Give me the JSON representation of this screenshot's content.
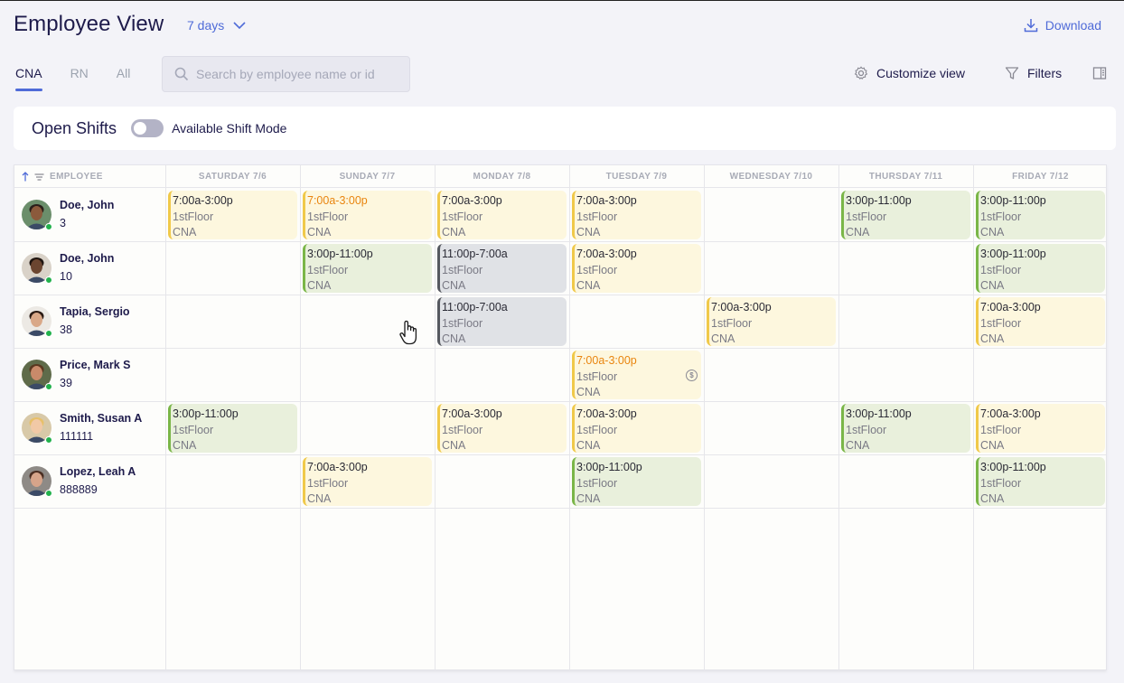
{
  "header": {
    "title": "Employee View",
    "range_label": "7 days",
    "download_label": "Download"
  },
  "tabs": [
    {
      "label": "CNA",
      "active": true
    },
    {
      "label": "RN",
      "active": false
    },
    {
      "label": "All",
      "active": false
    }
  ],
  "search": {
    "placeholder": "Search by employee name or id",
    "value": ""
  },
  "toolbar": {
    "customize_label": "Customize view",
    "filters_label": "Filters"
  },
  "open_shifts": {
    "label": "Open Shifts",
    "toggle_label": "Available Shift Mode",
    "toggle_on": false
  },
  "grid": {
    "employee_header": "EMPLOYEE",
    "days": [
      "SATURDAY 7/6",
      "SUNDAY 7/7",
      "MONDAY 7/8",
      "TUESDAY 7/9",
      "WEDNESDAY 7/10",
      "THURSDAY 7/11",
      "FRIDAY 7/12"
    ],
    "employees": [
      {
        "name": "Doe, John",
        "id": "3",
        "online": true
      },
      {
        "name": "Doe, John",
        "id": "10",
        "online": true
      },
      {
        "name": "Tapia, Sergio",
        "id": "38",
        "online": true
      },
      {
        "name": "Price, Mark S",
        "id": "39",
        "online": true
      },
      {
        "name": "Smith, Susan A",
        "id": "111111",
        "online": true
      },
      {
        "name": "Lopez, Leah A",
        "id": "888889",
        "online": true
      }
    ],
    "shifts": [
      {
        "row": 0,
        "day": 0,
        "time": "7:00a-3:00p",
        "location": "1stFloor",
        "role": "CNA",
        "kind": "day"
      },
      {
        "row": 0,
        "day": 1,
        "time": "7:00a-3:00p",
        "location": "1stFloor",
        "role": "CNA",
        "kind": "day",
        "alert": true
      },
      {
        "row": 0,
        "day": 2,
        "time": "7:00a-3:00p",
        "location": "1stFloor",
        "role": "CNA",
        "kind": "day"
      },
      {
        "row": 0,
        "day": 3,
        "time": "7:00a-3:00p",
        "location": "1stFloor",
        "role": "CNA",
        "kind": "day"
      },
      {
        "row": 0,
        "day": 5,
        "time": "3:00p-11:00p",
        "location": "1stFloor",
        "role": "CNA",
        "kind": "eve"
      },
      {
        "row": 0,
        "day": 6,
        "time": "3:00p-11:00p",
        "location": "1stFloor",
        "role": "CNA",
        "kind": "eve"
      },
      {
        "row": 1,
        "day": 1,
        "time": "3:00p-11:00p",
        "location": "1stFloor",
        "role": "CNA",
        "kind": "eve"
      },
      {
        "row": 1,
        "day": 2,
        "time": "11:00p-7:00a",
        "location": "1stFloor",
        "role": "CNA",
        "kind": "night"
      },
      {
        "row": 1,
        "day": 3,
        "time": "7:00a-3:00p",
        "location": "1stFloor",
        "role": "CNA",
        "kind": "day"
      },
      {
        "row": 1,
        "day": 6,
        "time": "3:00p-11:00p",
        "location": "1stFloor",
        "role": "CNA",
        "kind": "eve"
      },
      {
        "row": 2,
        "day": 2,
        "time": "11:00p-7:00a",
        "location": "1stFloor",
        "role": "CNA",
        "kind": "night"
      },
      {
        "row": 2,
        "day": 4,
        "time": "7:00a-3:00p",
        "location": "1stFloor",
        "role": "CNA",
        "kind": "day"
      },
      {
        "row": 2,
        "day": 6,
        "time": "7:00a-3:00p",
        "location": "1stFloor",
        "role": "CNA",
        "kind": "day"
      },
      {
        "row": 3,
        "day": 3,
        "time": "7:00a-3:00p",
        "location": "1stFloor",
        "role": "CNA",
        "kind": "day",
        "alert": true,
        "coin": "$"
      },
      {
        "row": 4,
        "day": 0,
        "time": "3:00p-11:00p",
        "location": "1stFloor",
        "role": "CNA",
        "kind": "eve"
      },
      {
        "row": 4,
        "day": 2,
        "time": "7:00a-3:00p",
        "location": "1stFloor",
        "role": "CNA",
        "kind": "day"
      },
      {
        "row": 4,
        "day": 3,
        "time": "7:00a-3:00p",
        "location": "1stFloor",
        "role": "CNA",
        "kind": "day"
      },
      {
        "row": 4,
        "day": 5,
        "time": "3:00p-11:00p",
        "location": "1stFloor",
        "role": "CNA",
        "kind": "eve"
      },
      {
        "row": 4,
        "day": 6,
        "time": "7:00a-3:00p",
        "location": "1stFloor",
        "role": "CNA",
        "kind": "day"
      },
      {
        "row": 5,
        "day": 1,
        "time": "7:00a-3:00p",
        "location": "1stFloor",
        "role": "CNA",
        "kind": "day"
      },
      {
        "row": 5,
        "day": 3,
        "time": "3:00p-11:00p",
        "location": "1stFloor",
        "role": "CNA",
        "kind": "eve"
      },
      {
        "row": 5,
        "day": 6,
        "time": "3:00p-11:00p",
        "location": "1stFloor",
        "role": "CNA",
        "kind": "eve"
      }
    ]
  },
  "colors": {
    "accent": "#4f6bd8",
    "day_shift_bg": "#fdf7de",
    "day_shift_bar": "#f0c94a",
    "evening_shift_bg": "#e9f0dc",
    "evening_shift_bar": "#7ab648",
    "night_shift_bg": "#e0e2e6",
    "night_shift_bar": "#55585f",
    "alert_text": "#e9850f",
    "online": "#22b14c"
  },
  "icons": [
    "chevron-down-icon",
    "download-icon",
    "search-icon",
    "gear-icon",
    "filter-icon",
    "panel-icon",
    "sort-arrow-icon",
    "sort-lines-icon",
    "dollar-coin-icon",
    "hand-cursor-icon"
  ]
}
